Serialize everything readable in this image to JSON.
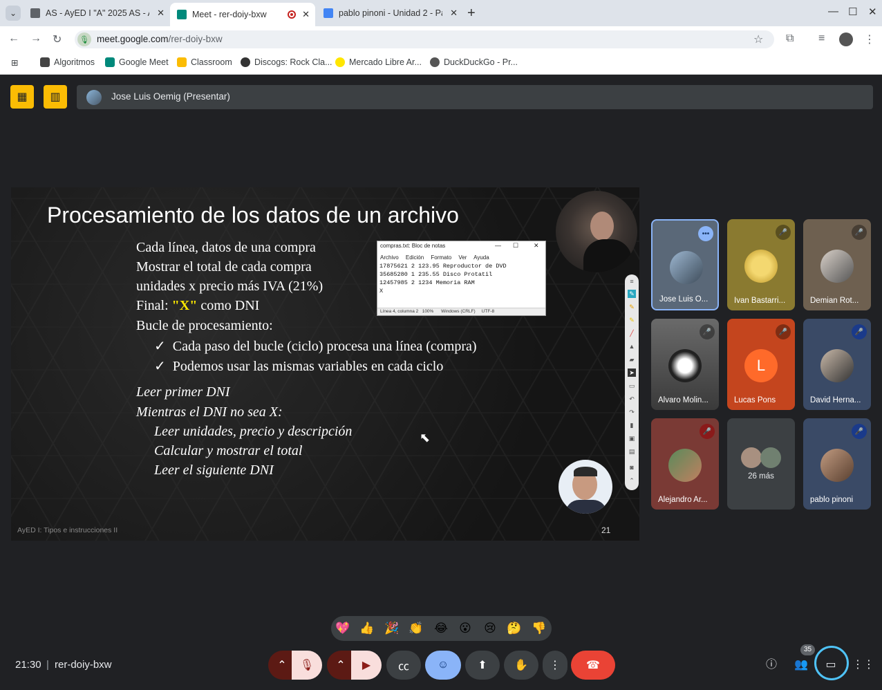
{
  "browser": {
    "tabs": [
      {
        "title": "AS - AyED I \"A\" 2025 AS - Al",
        "icon_color": "#5f6368"
      },
      {
        "title": "Meet - rer-doiy-bxw",
        "icon_color": "#00897b"
      },
      {
        "title": "pablo pinoni - Unidad 2 - Pa",
        "icon_color": "#4285f4"
      }
    ],
    "url_host": "meet.google.com",
    "url_path": "/rer-doiy-bxw",
    "bookmarks": [
      "Algoritmos",
      "Google Meet",
      "Classroom",
      "Discogs: Rock Cla...",
      "Mercado Libre Ar...",
      "DuckDuckGo - Pr..."
    ]
  },
  "meet": {
    "presenter_label": "Jose Luis Oemig (Presentar)",
    "slide": {
      "title": "Procesamiento de los datos de un archivo",
      "line1": "Cada línea, datos de una compra",
      "line2": "Mostrar el total de cada compra",
      "line3": "unidades x precio más IVA (21%)",
      "line4_a": "Final: ",
      "line4_x": "\"X\"",
      "line4_b": " como DNI",
      "line5": "Bucle de procesamiento:",
      "check1": "Cada paso del bucle (ciclo) procesa una línea (compra)",
      "check2": "Podemos usar las mismas variables en cada ciclo",
      "algo1": "Leer primer DNI",
      "algo2": "Mientras el DNI no sea X:",
      "algo3": "Leer unidades, precio y descripción",
      "algo4": "Calcular y mostrar el total",
      "algo5": "Leer el siguiente DNI",
      "footer": "AyED I: Tipos e instrucciones II",
      "page_number": "21",
      "notepad": {
        "title": "compras.txt: Bloc de notas",
        "menu": "Archivo Edición Formato Ver Ayuda",
        "lines": [
          "17875621 2 123.95 Reproductor de DVD",
          "35685280 1 235.55 Disco Protatil",
          "12457985 2 1234 Memoria RAM",
          "X"
        ],
        "status": "Línea 4, columna 2   100%      Windows (CRLF)     UTF-8"
      }
    },
    "participants": [
      {
        "name": "Jose Luis O...",
        "bg": "#5a6878"
      },
      {
        "name": "Ivan Bastarri...",
        "bg": "#8a7a30"
      },
      {
        "name": "Demian Rot...",
        "bg": "#6e6050"
      },
      {
        "name": "Alvaro Molin...",
        "bg": "#555"
      },
      {
        "name": "Lucas Pons",
        "bg": "#c4451e",
        "initial": "L"
      },
      {
        "name": "David Herna...",
        "bg": "#3a4a66"
      },
      {
        "name": "Alejandro Ar...",
        "bg": "#7a3a35"
      },
      {
        "name": "26 más",
        "bg": "#3c4043"
      },
      {
        "name": "pablo pinoni",
        "bg": "#3a4a66"
      }
    ],
    "reactions": [
      "💖",
      "👍",
      "🎉",
      "👏",
      "😂",
      "😮",
      "😢",
      "🤔",
      "👎"
    ],
    "time": "21:30",
    "meeting_code": "rer-doiy-bxw",
    "people_count": "35"
  }
}
